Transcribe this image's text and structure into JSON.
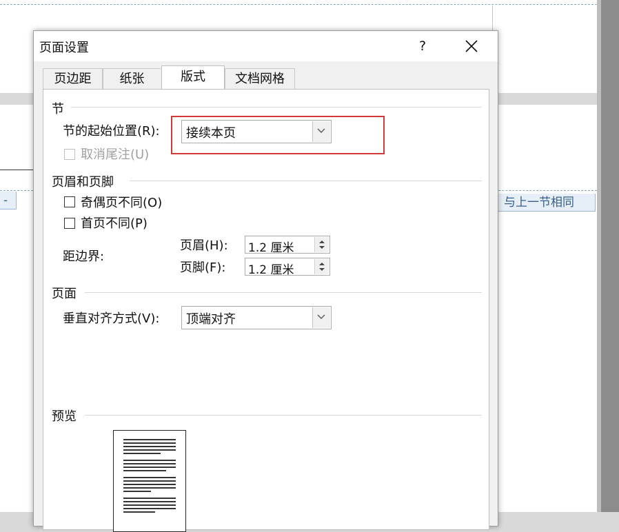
{
  "background": {
    "header_tag_left": "-",
    "header_tag_right": "与上一节相同"
  },
  "dialog": {
    "title": "页面设置",
    "help_label": "?",
    "tabs": [
      {
        "label": "页边距",
        "active": false
      },
      {
        "label": "纸张",
        "active": false
      },
      {
        "label": "版式",
        "active": true
      },
      {
        "label": "文档网格",
        "active": false
      }
    ],
    "section": {
      "heading": "节",
      "start_label": "节的起始位置(R):",
      "start_value": "接续本页",
      "suppress_endnotes_label": "取消尾注(U)"
    },
    "headers_footers": {
      "heading": "页眉和页脚",
      "odd_even_label": "奇偶页不同(O)",
      "first_page_label": "首页不同(P)",
      "distance_label": "距边界:",
      "header_label": "页眉(H):",
      "header_value": "1.2 厘米",
      "footer_label": "页脚(F):",
      "footer_value": "1.2 厘米"
    },
    "page": {
      "heading": "页面",
      "valign_label": "垂直对齐方式(V):",
      "valign_value": "顶端对齐"
    },
    "preview": {
      "heading": "预览"
    }
  },
  "colors": {
    "highlight": "#d23a3a",
    "dashed_boundary": "#7aa6cc"
  }
}
